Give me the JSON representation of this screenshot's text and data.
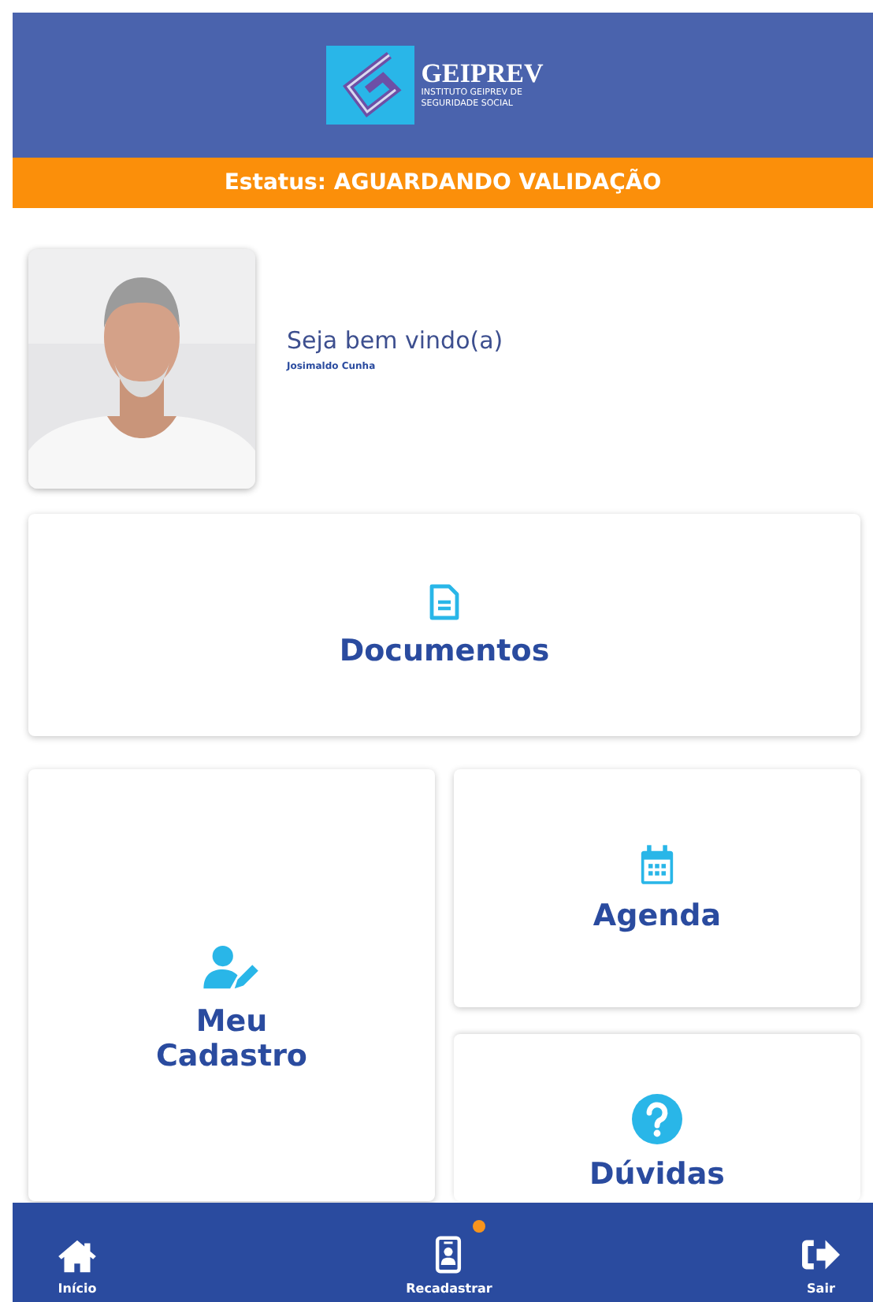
{
  "header": {
    "logo_name": "GEIPREV",
    "logo_subtitle": "INSTITUTO GEIPREV DE SEGURIDADE SOCIAL"
  },
  "status_bar": {
    "text": "Estatus: AGUARDANDO VALIDAÇÃO"
  },
  "profile": {
    "greeting": "Seja bem vindo(a)",
    "name": "Josimaldo Cunha"
  },
  "cards": [
    {
      "kind": "documents",
      "label": "Documentos"
    },
    {
      "kind": "profile-edit",
      "label": "Meu Cadastro"
    },
    {
      "kind": "calendar",
      "label": "Agenda"
    },
    {
      "kind": "help",
      "label": "Dúvidas"
    }
  ],
  "bottom_nav": [
    {
      "kind": "home",
      "label": "Início"
    },
    {
      "kind": "id-card",
      "label": "Recadastrar",
      "badge": true
    },
    {
      "kind": "exit",
      "label": "Sair"
    }
  ]
}
